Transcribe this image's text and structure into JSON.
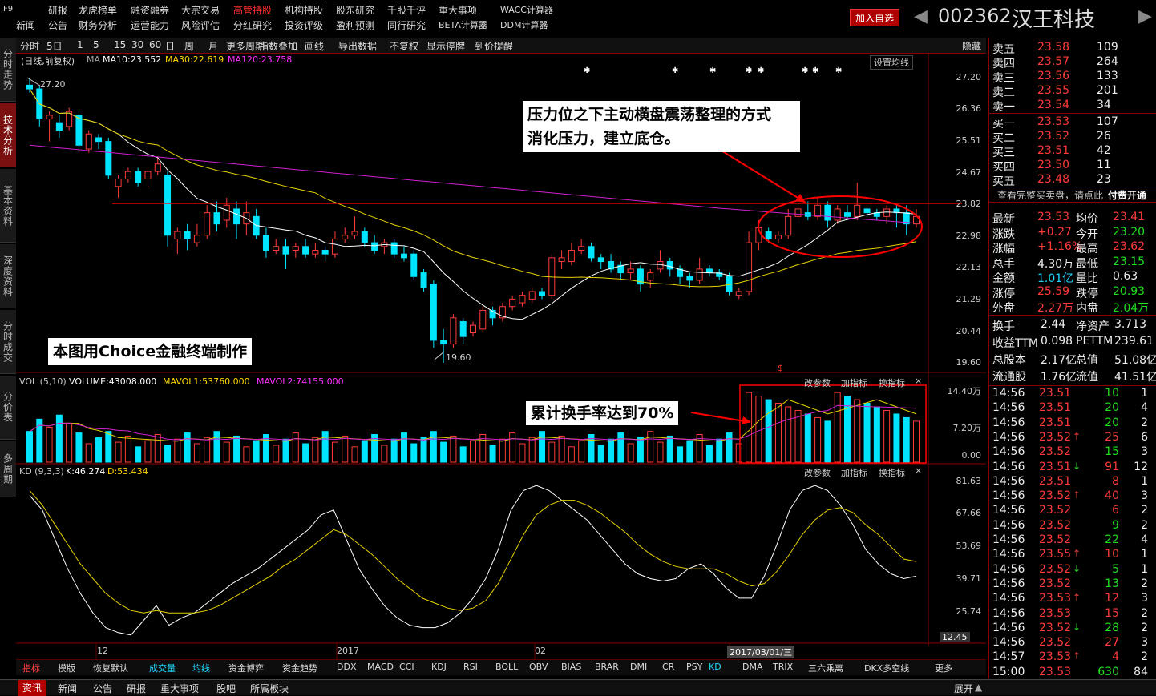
{
  "topbar": {
    "f9": "F9",
    "row1": [
      "研报",
      "龙虎榜单",
      "融资融券",
      "大宗交易",
      "高管持股",
      "机构持股",
      "股东研究",
      "千股千评",
      "重大事项",
      "WACC计算器"
    ],
    "row2": [
      "新闻",
      "公告",
      "财务分析",
      "运营能力",
      "风险评估",
      "分红研究",
      "投资评级",
      "盈利预测",
      "同行研究",
      "BETA计算器",
      "DDM计算器"
    ],
    "active": "高管持股",
    "add_fav": "加入自选",
    "code": "002362",
    "name": "汉王科技",
    "prev_arrow": "◀",
    "next_arrow": "▶"
  },
  "side_tabs": [
    "分时走势",
    "技术分析",
    "基本资料",
    "深度资料",
    "分时成交",
    "分价表",
    "多周期"
  ],
  "toolbar": {
    "items": [
      "分时",
      "5日",
      "1",
      "5",
      "15",
      "30",
      "60",
      "日",
      "周",
      "月",
      "更多周期",
      "指数叠加",
      "画线",
      "导出数据",
      "不复权",
      "显示停牌",
      "到价提醒"
    ],
    "hide": "隐藏"
  },
  "kline": {
    "header_prefix": "(日线,前复权)",
    "ma": "MA",
    "ma10": "MA10:23.552",
    "ma30": "MA30:22.619",
    "ma120": "MA120:23.758",
    "set_ma": "设置均线",
    "high_label": "27.20",
    "low_label": "19.60",
    "price_axis": [
      "27.20",
      "26.36",
      "25.51",
      "24.67",
      "23.82",
      "22.98",
      "22.13",
      "21.29",
      "20.44",
      "19.60"
    ],
    "note1_line1": "压力位之下主动横盘震荡整理的方式",
    "note1_line2": "消化压力，建立底仓。",
    "note2": "本图用Choice金融终端制作",
    "dollar": "$"
  },
  "vol": {
    "header": "VOL (5,10)",
    "volume": "VOLUME:43008.000",
    "mavol1": "MAVOL1:53760.000",
    "mavol2": "MAVOL2:74155.000",
    "axis": [
      "14.40万",
      "7.20万",
      "0.00"
    ],
    "note": "累计换手率达到70%",
    "btns": [
      "改参数",
      "加指标",
      "换指标"
    ],
    "close": "×"
  },
  "kd": {
    "header": "KD (9,3,3)",
    "k": "K:46.274",
    "d": "D:53.434",
    "axis": [
      "81.63",
      "67.66",
      "53.69",
      "39.71",
      "25.74"
    ],
    "btns": [
      "改参数",
      "加指标",
      "换指标"
    ],
    "close": "×"
  },
  "time_axis": {
    "labels": [
      "12",
      "2017",
      "02"
    ],
    "cursor_date": "2017/03/01/三",
    "cursor_value": "12.45"
  },
  "order_book": {
    "asks": [
      {
        "label": "卖五",
        "price": "23.58",
        "vol": "109"
      },
      {
        "label": "卖四",
        "price": "23.57",
        "vol": "264"
      },
      {
        "label": "卖三",
        "price": "23.56",
        "vol": "133"
      },
      {
        "label": "卖二",
        "price": "23.55",
        "vol": "201"
      },
      {
        "label": "卖一",
        "price": "23.54",
        "vol": "34"
      }
    ],
    "bids": [
      {
        "label": "买一",
        "price": "23.53",
        "vol": "107"
      },
      {
        "label": "买二",
        "price": "23.52",
        "vol": "26"
      },
      {
        "label": "买三",
        "price": "23.51",
        "vol": "42"
      },
      {
        "label": "买四",
        "price": "23.50",
        "vol": "11"
      },
      {
        "label": "买五",
        "price": "23.48",
        "vol": "23"
      }
    ],
    "full_book": "查看完整买卖盘，请点此",
    "paid": "付费开通"
  },
  "quote": [
    {
      "l1": "最新",
      "v1": "23.53",
      "c1": "red",
      "l2": "均价",
      "v2": "23.41",
      "c2": "red"
    },
    {
      "l1": "涨跌",
      "v1": "+0.27",
      "c1": "red",
      "l2": "今开",
      "v2": "23.20",
      "c2": "green"
    },
    {
      "l1": "涨幅",
      "v1": "+1.16%",
      "c1": "red",
      "l2": "最高",
      "v2": "23.62",
      "c2": "red"
    },
    {
      "l1": "总手",
      "v1": "4.30万",
      "c1": "white",
      "l2": "最低",
      "v2": "23.15",
      "c2": "green"
    },
    {
      "l1": "金额",
      "v1": "1.01亿",
      "c1": "cyan",
      "l2": "量比",
      "v2": "0.63",
      "c2": "white"
    },
    {
      "l1": "涨停",
      "v1": "25.59",
      "c1": "red",
      "l2": "跌停",
      "v2": "20.93",
      "c2": "green"
    },
    {
      "l1": "外盘",
      "v1": "2.27万",
      "c1": "red",
      "l2": "内盘",
      "v2": "2.04万",
      "c2": "green"
    }
  ],
  "fundamentals": [
    {
      "l1": "换手",
      "v1": "2.44",
      "l2": "净资产",
      "v2": "3.713"
    },
    {
      "l1": "收益TTM",
      "v1": "0.098",
      "l2": "PETTM",
      "v2": "239.61"
    },
    {
      "l1": "总股本",
      "v1": "2.17亿",
      "l2": "总值",
      "v2": "51.08亿"
    },
    {
      "l1": "流通股",
      "v1": "1.76亿",
      "l2": "流值",
      "v2": "41.51亿"
    }
  ],
  "ticks": [
    {
      "t": "14:56",
      "p": "23.51",
      "c": "red",
      "a": "",
      "v": "10",
      "vc": "green",
      "n": "1"
    },
    {
      "t": "14:56",
      "p": "23.51",
      "c": "red",
      "a": "",
      "v": "20",
      "vc": "green",
      "n": "4"
    },
    {
      "t": "14:56",
      "p": "23.51",
      "c": "red",
      "a": "",
      "v": "20",
      "vc": "green",
      "n": "2"
    },
    {
      "t": "14:56",
      "p": "23.52",
      "c": "red",
      "a": "↑",
      "ac": "red",
      "v": "25",
      "vc": "red",
      "n": "6"
    },
    {
      "t": "14:56",
      "p": "23.52",
      "c": "red",
      "a": "",
      "v": "15",
      "vc": "green",
      "n": "3"
    },
    {
      "t": "14:56",
      "p": "23.51",
      "c": "red",
      "a": "↓",
      "ac": "green",
      "v": "91",
      "vc": "red",
      "n": "12"
    },
    {
      "t": "14:56",
      "p": "23.51",
      "c": "red",
      "a": "",
      "v": "8",
      "vc": "red",
      "n": "1"
    },
    {
      "t": "14:56",
      "p": "23.52",
      "c": "red",
      "a": "↑",
      "ac": "red",
      "v": "40",
      "vc": "red",
      "n": "3"
    },
    {
      "t": "14:56",
      "p": "23.52",
      "c": "red",
      "a": "",
      "v": "6",
      "vc": "red",
      "n": "2"
    },
    {
      "t": "14:56",
      "p": "23.52",
      "c": "red",
      "a": "",
      "v": "9",
      "vc": "green",
      "n": "2"
    },
    {
      "t": "14:56",
      "p": "23.52",
      "c": "red",
      "a": "",
      "v": "22",
      "vc": "green",
      "n": "4"
    },
    {
      "t": "14:56",
      "p": "23.55",
      "c": "red",
      "a": "↑",
      "ac": "red",
      "v": "10",
      "vc": "red",
      "n": "1"
    },
    {
      "t": "14:56",
      "p": "23.52",
      "c": "red",
      "a": "↓",
      "ac": "green",
      "v": "5",
      "vc": "green",
      "n": "1"
    },
    {
      "t": "14:56",
      "p": "23.52",
      "c": "red",
      "a": "",
      "v": "13",
      "vc": "green",
      "n": "2"
    },
    {
      "t": "14:56",
      "p": "23.53",
      "c": "red",
      "a": "↑",
      "ac": "red",
      "v": "12",
      "vc": "red",
      "n": "3"
    },
    {
      "t": "14:56",
      "p": "23.53",
      "c": "red",
      "a": "",
      "v": "15",
      "vc": "red",
      "n": "2"
    },
    {
      "t": "14:56",
      "p": "23.52",
      "c": "red",
      "a": "↓",
      "ac": "green",
      "v": "28",
      "vc": "green",
      "n": "2"
    },
    {
      "t": "14:56",
      "p": "23.52",
      "c": "red",
      "a": "",
      "v": "27",
      "vc": "red",
      "n": "3"
    },
    {
      "t": "14:57",
      "p": "23.53",
      "c": "red",
      "a": "↑",
      "ac": "red",
      "v": "4",
      "vc": "red",
      "n": "2"
    },
    {
      "t": "15:00",
      "p": "23.53",
      "c": "red",
      "a": "",
      "v": "630",
      "vc": "green",
      "n": "84"
    }
  ],
  "right_tabs": [
    "分笔",
    "分价",
    "分时",
    "财务",
    "指数",
    "资料"
  ],
  "indicator_tabs": [
    "指标",
    "模版",
    "恢复默认",
    "成交量",
    "均线",
    "资金博弈",
    "资金趋势",
    "DDX",
    "MACD",
    "CCI",
    "KDJ",
    "RSI",
    "BOLL",
    "OBV",
    "BIAS",
    "BRAR",
    "DMI",
    "CR",
    "PSY",
    "KD",
    "DMA",
    "TRIX",
    "三六乘离",
    "DKX多空线",
    "更多"
  ],
  "bottom_tabs": [
    "资讯",
    "新闻",
    "公告",
    "研报",
    "重大事项",
    "股吧",
    "所属板块"
  ],
  "bottom_right": "展开",
  "chart_data": {
    "type": "candlestick",
    "y_range": [
      19.6,
      27.2
    ],
    "resistance_line": 23.85,
    "candles": [
      [
        27.0,
        26.9,
        27.2,
        26.8
      ],
      [
        26.9,
        26.1,
        27.0,
        25.9
      ],
      [
        26.1,
        26.2,
        26.3,
        25.5
      ],
      [
        26.0,
        25.8,
        26.2,
        25.6
      ],
      [
        25.9,
        26.3,
        26.4,
        25.8
      ],
      [
        26.2,
        25.4,
        26.3,
        25.2
      ],
      [
        25.3,
        25.7,
        25.8,
        25.2
      ],
      [
        25.6,
        25.5,
        25.7,
        25.3
      ],
      [
        25.5,
        24.6,
        25.6,
        24.5
      ],
      [
        24.3,
        24.5,
        24.6,
        24.0
      ],
      [
        24.5,
        24.7,
        24.8,
        24.4
      ],
      [
        24.7,
        24.4,
        24.8,
        24.3
      ],
      [
        24.5,
        24.7,
        24.8,
        24.3
      ],
      [
        24.7,
        24.9,
        25.1,
        24.6
      ],
      [
        24.6,
        23.0,
        24.7,
        22.7
      ],
      [
        22.9,
        23.1,
        23.2,
        22.5
      ],
      [
        23.1,
        22.9,
        23.3,
        22.6
      ],
      [
        22.8,
        23.0,
        23.3,
        22.7
      ],
      [
        23.0,
        23.6,
        23.8,
        22.9
      ],
      [
        23.6,
        23.3,
        23.9,
        23.1
      ],
      [
        23.4,
        23.8,
        24.0,
        23.2
      ],
      [
        23.7,
        23.3,
        23.9,
        22.9
      ],
      [
        23.3,
        23.6,
        23.9,
        23.0
      ],
      [
        23.5,
        23.0,
        23.7,
        22.9
      ],
      [
        23.0,
        22.6,
        23.2,
        22.4
      ],
      [
        22.6,
        22.7,
        22.9,
        22.5
      ],
      [
        22.7,
        22.5,
        22.9,
        22.1
      ],
      [
        22.6,
        22.7,
        22.8,
        22.4
      ],
      [
        22.7,
        22.5,
        22.9,
        22.4
      ],
      [
        22.5,
        22.6,
        22.8,
        22.4
      ],
      [
        22.6,
        22.5,
        22.7,
        22.3
      ],
      [
        22.5,
        22.9,
        23.1,
        22.4
      ],
      [
        22.9,
        23.0,
        23.2,
        22.8
      ],
      [
        23.0,
        23.1,
        23.5,
        22.9
      ],
      [
        23.1,
        22.8,
        23.2,
        22.7
      ],
      [
        22.8,
        22.6,
        23.0,
        22.5
      ],
      [
        22.7,
        22.8,
        22.9,
        22.5
      ],
      [
        22.8,
        22.5,
        22.9,
        22.4
      ],
      [
        22.5,
        22.4,
        22.7,
        22.3
      ],
      [
        22.5,
        21.9,
        22.6,
        21.8
      ],
      [
        22.0,
        21.6,
        22.1,
        21.5
      ],
      [
        21.7,
        20.2,
        21.8,
        20.0
      ],
      [
        20.2,
        20.1,
        20.5,
        19.6
      ],
      [
        20.1,
        20.8,
        20.9,
        20.0
      ],
      [
        20.7,
        20.3,
        20.8,
        20.1
      ],
      [
        20.4,
        20.6,
        20.7,
        20.3
      ],
      [
        20.5,
        21.0,
        21.1,
        20.4
      ],
      [
        21.0,
        20.8,
        21.1,
        20.6
      ],
      [
        20.8,
        21.1,
        21.2,
        20.7
      ],
      [
        21.1,
        21.3,
        21.4,
        21.0
      ],
      [
        21.2,
        21.4,
        21.5,
        21.1
      ],
      [
        21.3,
        21.5,
        21.6,
        21.2
      ],
      [
        21.5,
        21.4,
        21.6,
        21.3
      ],
      [
        21.4,
        22.4,
        22.5,
        21.3
      ],
      [
        22.3,
        22.4,
        22.6,
        22.1
      ],
      [
        22.3,
        22.6,
        22.8,
        22.2
      ],
      [
        22.6,
        22.7,
        22.9,
        22.5
      ],
      [
        22.7,
        22.4,
        22.8,
        22.3
      ],
      [
        22.4,
        22.3,
        22.5,
        22.1
      ],
      [
        22.3,
        22.1,
        22.5,
        22.0
      ],
      [
        22.2,
        22.0,
        22.3,
        21.8
      ],
      [
        22.0,
        22.1,
        22.3,
        21.8
      ],
      [
        22.1,
        21.7,
        22.2,
        21.5
      ],
      [
        21.8,
        22.0,
        22.1,
        21.6
      ],
      [
        22.1,
        22.3,
        22.6,
        22.0
      ],
      [
        22.3,
        22.1,
        22.4,
        21.9
      ],
      [
        22.1,
        21.9,
        22.2,
        21.7
      ],
      [
        21.9,
        21.8,
        22.0,
        21.6
      ],
      [
        21.8,
        22.1,
        22.4,
        21.7
      ],
      [
        22.1,
        22.0,
        22.2,
        21.9
      ],
      [
        22.0,
        21.9,
        22.1,
        21.8
      ],
      [
        21.9,
        21.5,
        22.0,
        21.4
      ],
      [
        21.4,
        21.5,
        21.6,
        21.3
      ],
      [
        21.5,
        22.8,
        23.1,
        21.4
      ],
      [
        22.8,
        23.2,
        23.4,
        22.6
      ],
      [
        23.1,
        22.9,
        23.2,
        22.8
      ],
      [
        22.9,
        23.0,
        23.1,
        22.8
      ],
      [
        23.0,
        23.5,
        23.7,
        22.9
      ],
      [
        23.5,
        23.7,
        23.9,
        23.3
      ],
      [
        23.6,
        23.5,
        23.9,
        23.4
      ],
      [
        23.5,
        23.8,
        24.0,
        23.4
      ],
      [
        23.8,
        23.4,
        23.9,
        23.2
      ],
      [
        23.4,
        23.7,
        23.8,
        23.3
      ],
      [
        23.6,
        23.5,
        23.8,
        23.4
      ],
      [
        23.5,
        23.8,
        24.4,
        23.4
      ],
      [
        23.7,
        23.6,
        23.8,
        23.5
      ],
      [
        23.6,
        23.5,
        23.7,
        23.4
      ],
      [
        23.5,
        23.7,
        23.8,
        23.3
      ],
      [
        23.7,
        23.6,
        23.8,
        23.2
      ],
      [
        23.6,
        23.3,
        23.8,
        23.0
      ],
      [
        23.3,
        23.5,
        23.7,
        23.2
      ]
    ],
    "volume_axis": [
      0,
      144000
    ]
  }
}
